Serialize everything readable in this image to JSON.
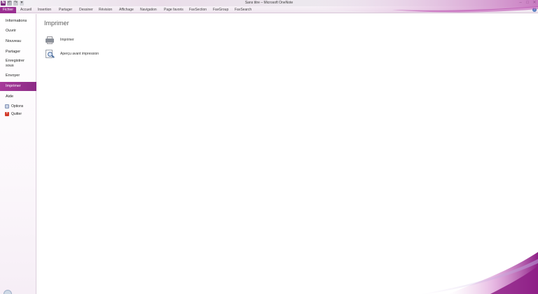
{
  "window": {
    "title": "Sans titre – Microsoft OneNote",
    "accent_color": "#9b2f92"
  },
  "quick_access": {
    "app_icon": "N",
    "icons": [
      "onenote-app-icon",
      "undo-icon",
      "redo-icon",
      "customize-icon"
    ]
  },
  "ribbon_tabs": [
    {
      "label": "Fichier",
      "selected": true
    },
    {
      "label": "Accueil"
    },
    {
      "label": "Insertion"
    },
    {
      "label": "Partager"
    },
    {
      "label": "Dessiner"
    },
    {
      "label": "Révision"
    },
    {
      "label": "Affichage"
    },
    {
      "label": "Navigation"
    },
    {
      "label": "Page favoris"
    },
    {
      "label": "FavSection"
    },
    {
      "label": "FavGroup"
    },
    {
      "label": "FavSearch"
    }
  ],
  "backstage_nav": {
    "items": [
      {
        "label": "Informations"
      },
      {
        "label": "Ouvrir"
      },
      {
        "label": "Nouveau"
      },
      {
        "label": "Partager"
      },
      {
        "label": "Enregistrer sous"
      },
      {
        "label": "Envoyer"
      },
      {
        "label": "Imprimer",
        "selected": true
      },
      {
        "label": "Aide"
      }
    ],
    "sub_items": [
      {
        "label": "Options",
        "icon": "options-icon"
      },
      {
        "label": "Quitter",
        "icon": "quit-icon"
      }
    ]
  },
  "main": {
    "title": "Imprimer",
    "commands": [
      {
        "label": "Imprimer",
        "icon": "printer-icon"
      },
      {
        "label": "Aperçu avant impression",
        "icon": "print-preview-icon"
      }
    ]
  }
}
